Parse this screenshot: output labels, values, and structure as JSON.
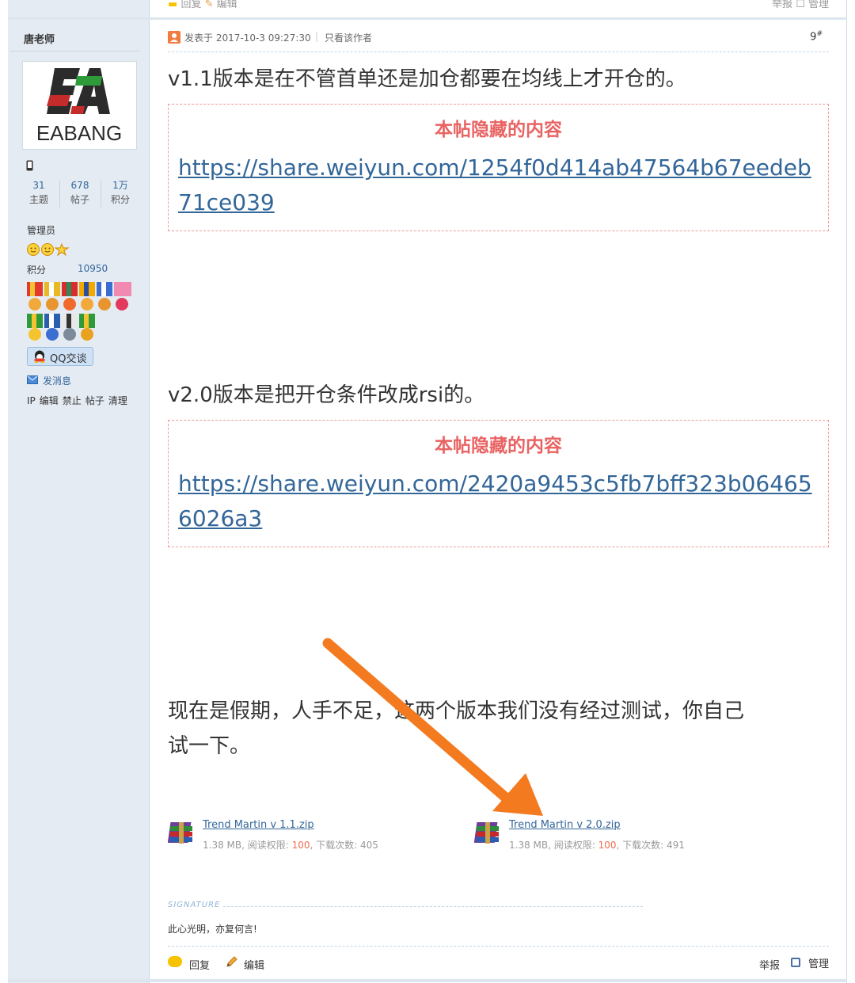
{
  "prev_post": {
    "reply_label": "回复",
    "edit_label": "编辑",
    "report_label": "举报",
    "manage_label": "管理"
  },
  "author": {
    "name": "唐老师",
    "avatar_text": "EABANG",
    "stats": [
      {
        "value": "31",
        "label": "主题"
      },
      {
        "value": "678",
        "label": "帖子"
      },
      {
        "value": "1万",
        "label": "积分"
      }
    ],
    "group": "管理员",
    "credits_label": "积分",
    "credits_value": "10950",
    "qq_label": "QQ交谈",
    "message_label": "发消息",
    "admin_links": [
      "IP",
      "编辑",
      "禁止",
      "帖子",
      "清理"
    ]
  },
  "post": {
    "posted_at": "发表于 2017-10-3 09:27:30",
    "separator": "|",
    "only_author": "只看该作者",
    "floor": "9",
    "floor_mark": "#",
    "paragraph_1": "v1.1版本是在不管首单还是加仓都要在均线上才开仓的。",
    "hidden_title_1": "本帖隐藏的内容",
    "hidden_link_1": "https://share.weiyun.com/1254f0d414ab47564b67eedeb71ce039",
    "paragraph_2": "v2.0版本是把开仓条件改成rsi的。",
    "hidden_title_2": "本帖隐藏的内容",
    "hidden_link_2": "https://share.weiyun.com/2420a9453c5fb7bff323b064656026a3",
    "paragraph_3_line1": "现在是假期，人手不足，这两个版本我们没有经过测试，你自己",
    "paragraph_3_line2": "试一下。",
    "attachments": [
      {
        "name": "Trend Martin v 1.1.zip",
        "size": "1.38 MB, 阅读权限: ",
        "permission": "100",
        "downloads": ", 下载次数: 405"
      },
      {
        "name": "Trend Martin v 2.0.zip",
        "size": "1.38 MB, 阅读权限: ",
        "permission": "100",
        "downloads": ", 下载次数: 491"
      }
    ],
    "signature_label": "SIGNATURE",
    "signature_text": "此心光明，亦复何言!"
  },
  "footer": {
    "reply_label": "回复",
    "edit_label": "编辑",
    "report_label": "举报",
    "manage_label": "管理"
  },
  "colors": {
    "sidebar_bg": "#e4ebf3",
    "link": "#336699",
    "hidden_title": "#e96363",
    "hidden_border": "#f19999",
    "annotation_arrow": "#f47a20"
  }
}
